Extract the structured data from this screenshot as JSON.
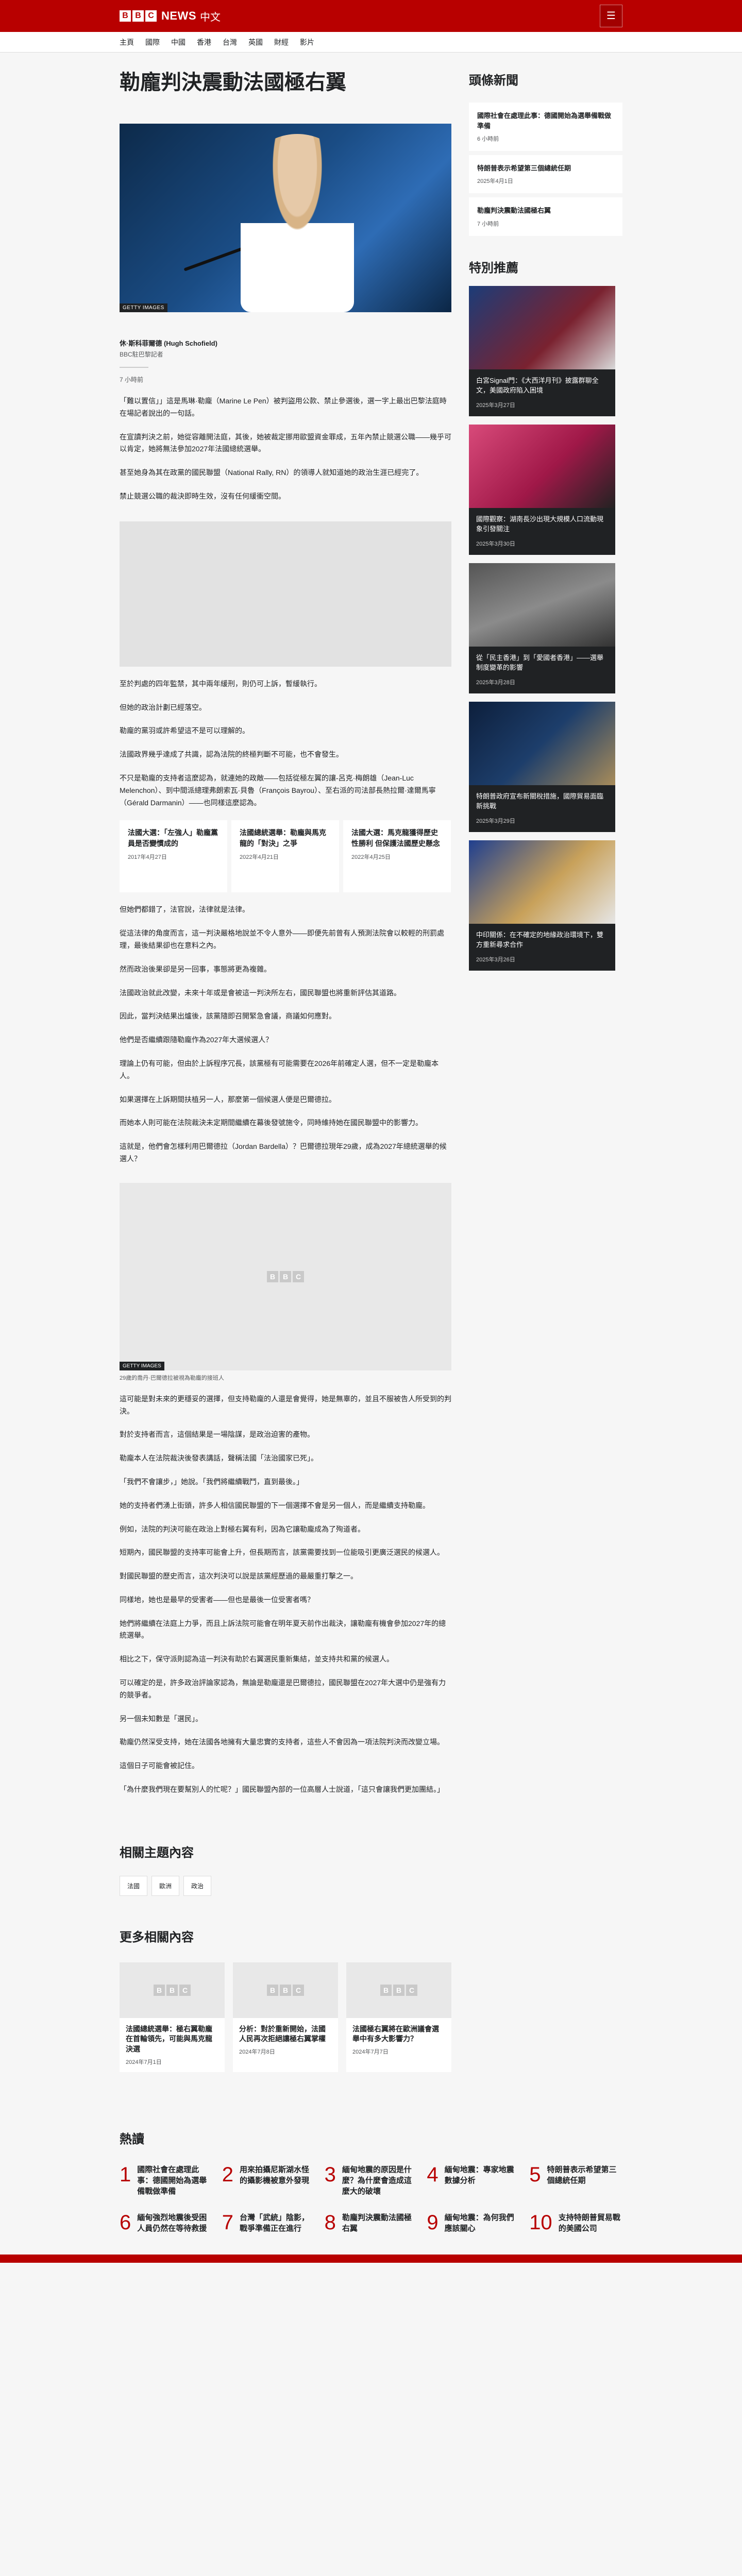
{
  "header": {
    "brand_blocks": [
      "B",
      "B",
      "C"
    ],
    "brand_name": "NEWS",
    "brand_lang": "中文",
    "menu_icon": "menu-icon"
  },
  "nav": [
    "主頁",
    "國際",
    "中國",
    "香港",
    "台灣",
    "英國",
    "財經",
    "影片"
  ],
  "article": {
    "title": "勒龐判決震動法國極右翼",
    "hero_credit": "GETTY IMAGES",
    "author": "休·斯科菲爾德 (Hugh Schofield)",
    "role": "BBC駐巴黎記者",
    "time": "7 小時前",
    "paras_a": [
      "「難以置信」」這是馬琳·勒龐（Marine Le Pen）被判盜用公款、禁止參選後，選一字上最出巴黎法庭時在場記者說出的一句話。",
      "在宣讀判決之前，她從容離開法庭，其後，她被裁定挪用歐盟資金罪成，五年內禁止競選公職——幾乎可以肯定，她將無法參加2027年法國總統選舉。",
      "甚至她身為其在政黨的國民聯盟（National Rally, RN）的領導人就知道她的政治生涯已經完了。",
      "禁止競選公職的裁決即時生效，沒有任何緩衝空間。"
    ],
    "paras_b": [
      "至於判處的四年監禁，其中兩年緩刑，則仍可上訴，暫緩執行。",
      "但她的政治計劃已經落空。",
      "勒龐的黨羽或許希望這不是可以理解的。",
      "法國政界幾乎達成了共識，認為法院的終極判斷不可能，也不會發生。",
      "不只是勒龐的支持者這麼認為，就連她的政敵——包括從極左翼的讓-呂克·梅朗雄（Jean-Luc Melenchon）、到中間派總理弗朗索瓦·貝魯（François Bayrou）、至右派的司法部長熱拉爾·達爾馬寧（Gérald Darmanin）——也同樣這麼認為。"
    ],
    "related_cards": [
      {
        "title": "法國大選：「左強人」勒龐黨員是否變慣成的",
        "date": "2017年4月27日"
      },
      {
        "title": "法國總統選舉：勒龐與馬克龍的「對決」之爭",
        "date": "2022年4月21日"
      },
      {
        "title": "法國大選：馬克龍獲得歷史性勝利 但保護法國歷史懸念",
        "date": "2022年4月25日"
      }
    ],
    "paras_c": [
      "但她們都錯了，法官說，法律就是法律。",
      "從這法律的角度而言，這一判決嚴格地說並不令人意外——即便先前曾有人預測法院會以較輕的刑罰處理，最後結果卻也在意料之內。",
      "然而政治後果卻是另一回事，事態將更為複雜。",
      "法國政治就此改變，未來十年或是會被這一判決所左右，國民聯盟也將重新評估其道路。",
      "因此，當判決結果出爐後，該黨隨即召開緊急會議，商議如何應對。",
      "他們是否繼續跟隨勒龐作為2027年大選候選人？",
      "理論上仍有可能，但由於上訴程序冗長，該黨極有可能需要在2026年前確定人選，但不一定是勒龐本人。",
      "如果選擇在上訴期間扶植另一人，那麼第一個候選人便是巴爾德拉。",
      "而她本人則可能在法院裁決未定期間繼續在幕後發號施令，同時維持她在國民聯盟中的影響力。",
      "這就是，他們會怎樣利用巴爾德拉（Jordan Bardella）？巴爾德拉現年29歲，成為2027年總統選舉的候選人？"
    ],
    "img2_credit": "GETTY IMAGES",
    "img2_caption": "29歲的喬丹·巴爾德拉被視為勒龐的接班人",
    "paras_d": [
      "這可能是對未來的更穩妥的選擇，但支持勒龐的人還是會覺得，她是無辜的，並且不服被告人所受到的判決。",
      "對於支持者而言，這個結果是一場陰謀，是政治迫害的產物。",
      "勒龐本人在法院裁決後發表講話，聲稱法國「法治國家已死」。",
      "「我們不會讓步，」她說。「我們將繼續戰鬥，直到最後。」",
      "她的支持者們湧上街頭，許多人相信國民聯盟的下一個選擇不會是另一個人，而是繼續支持勒龐。",
      "例如，法院的判決可能在政治上對極右翼有利，因為它讓勒龐成為了殉道者。",
      "短期內，國民聯盟的支持率可能會上升，但長期而言，該黨需要找到一位能吸引更廣泛選民的候選人。",
      "對國民聯盟的歷史而言，這次判決可以說是該黨經歷過的最嚴重打擊之一。",
      "同樣地，她也是最早的受害者——但也是最後一位受害者嗎？",
      "她們將繼續在法庭上力爭，而且上訴法院可能會在明年夏天前作出裁決，讓勒龐有機會參加2027年的總統選舉。",
      "相比之下，保守派則認為這一判決有助於右翼選民重新集結，並支持共和黨的候選人。",
      "可以確定的是，許多政治評論家認為，無論是勒龐還是巴爾德拉，國民聯盟在2027年大選中仍是強有力的競爭者。",
      "另一個未知數是「選民」。",
      "勒龐仍然深受支持，她在法國各地擁有大量忠實的支持者，這些人不會因為一項法院判決而改變立場。",
      "這個日子可能會被記住。",
      "「為什麼我們現在要幫別人的忙呢？」國民聯盟內部的一位高層人士說道，「這只會讓我們更加團結。」"
    ],
    "related_topics_title": "相關主題內容",
    "tags": [
      "法國",
      "歐洲",
      "政治"
    ],
    "more_title": "更多相關內容",
    "more_cards": [
      {
        "title": "法國總統選舉：極右翼勒龐在首輪領先，可能與馬克龍決選",
        "date": "2024年7月1日"
      },
      {
        "title": "分析：對於重新開始，法國人民再次拒絕讓極右翼掌權",
        "date": "2024年7月8日"
      },
      {
        "title": "法國極右翼將在歐洲議會選舉中有多大影響力？",
        "date": "2024年7月7日"
      }
    ]
  },
  "sidebar": {
    "latest_title": "頭條新聞",
    "latest": [
      {
        "title": "國際社會在處理此事：德國開始為選舉備戰做準備",
        "time": "6 小時前"
      },
      {
        "title": "特朗普表示希望第三個總統任期",
        "time": "2025年4月1日"
      },
      {
        "title": "勒龐判決震動法國極右翼",
        "time": "7 小時前"
      }
    ],
    "featured_title": "特別推薦",
    "featured": [
      {
        "title": "白宮Signal門：《大西洋月刊》披露群聊全文，美國政府陷入困境",
        "date": "2025年3月27日"
      },
      {
        "title": "國際觀察：湖南長沙出現大規模人口流動現象引發關注",
        "date": "2025年3月30日"
      },
      {
        "title": "從「民主香港」到「愛國者香港」——選舉制度變革的影響",
        "date": "2025年3月28日"
      },
      {
        "title": "特朗普政府宣布新關稅措施，國際貿易面臨新挑戰",
        "date": "2025年3月29日"
      },
      {
        "title": "中印關係：在不確定的地緣政治環境下，雙方重新尋求合作",
        "date": "2025年3月26日"
      }
    ]
  },
  "popular": {
    "title": "熱讀",
    "items": [
      {
        "n": "1",
        "title": "國際社會在處理此事：德國開始為選舉備戰做準備"
      },
      {
        "n": "2",
        "title": "用來拍攝尼斯湖水怪的攝影機被意外發現"
      },
      {
        "n": "3",
        "title": "緬甸地震的原因是什麼？為什麼會造成這麼大的破壞"
      },
      {
        "n": "4",
        "title": "緬甸地震：專家地震數據分析"
      },
      {
        "n": "5",
        "title": "特朗普表示希望第三個總統任期"
      },
      {
        "n": "6",
        "title": "緬甸強烈地震後受困人員仍然在等待救援"
      },
      {
        "n": "7",
        "title": "台灣「武統」陰影，戰爭準備正在進行"
      },
      {
        "n": "8",
        "title": "勒龐判決震動法國極右翼"
      },
      {
        "n": "9",
        "title": "緬甸地震：為何我們應該關心"
      },
      {
        "n": "10",
        "title": "支持特朗普貿易戰的美國公司"
      }
    ]
  },
  "colors": {
    "brand_red": "#b80000",
    "ink": "#202224"
  }
}
